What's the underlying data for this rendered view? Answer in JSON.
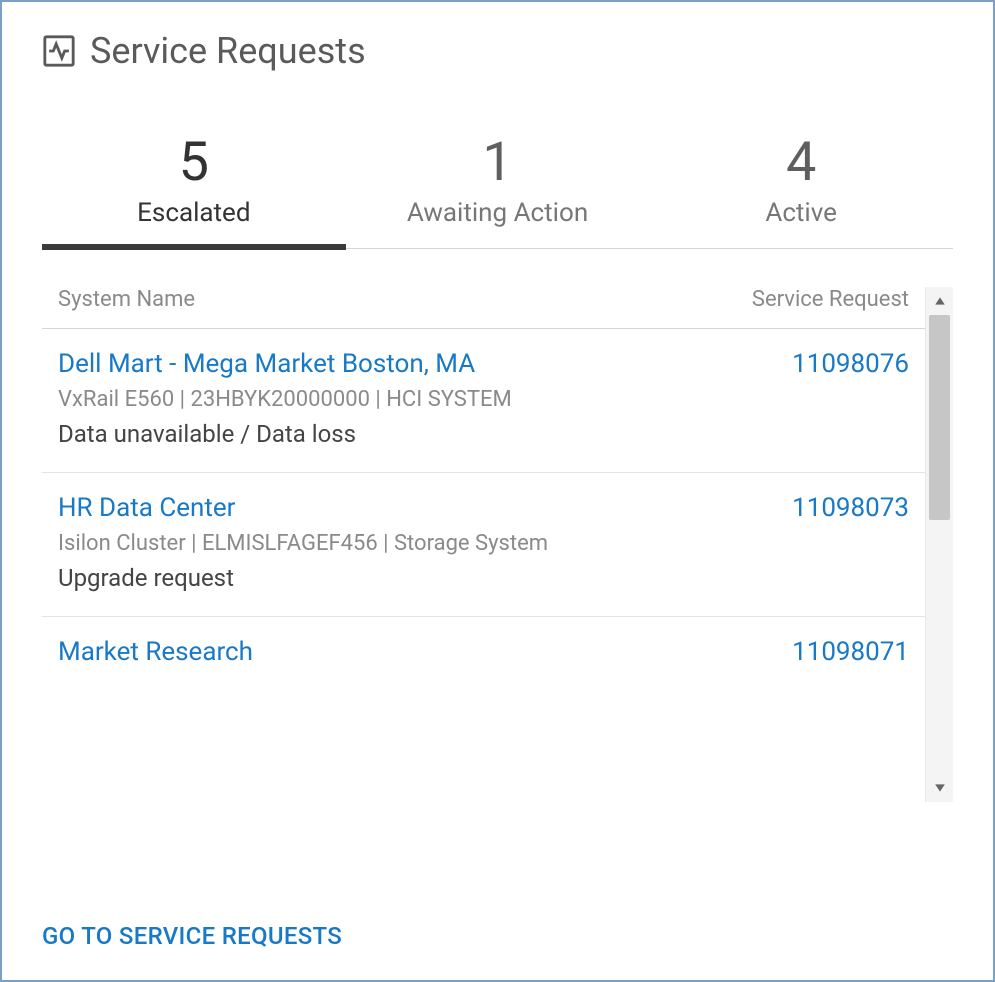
{
  "header": {
    "title": "Service Requests"
  },
  "tabs": [
    {
      "count": "5",
      "label": "Escalated",
      "selected": true
    },
    {
      "count": "1",
      "label": "Awaiting Action",
      "selected": false
    },
    {
      "count": "4",
      "label": "Active",
      "selected": false
    }
  ],
  "table": {
    "col_name": "System Name",
    "col_request": "Service Request",
    "rows": [
      {
        "system": "Dell Mart - Mega Market Boston, MA",
        "sub": "VxRail E560 | 23HBYK20000000 | HCI SYSTEM",
        "issue": "Data unavailable / Data loss",
        "request": "11098076"
      },
      {
        "system": "HR Data Center",
        "sub": "Isilon Cluster | ELMISLFAGEF456 | Storage System",
        "issue": "Upgrade request",
        "request": "11098073"
      },
      {
        "system": "Market Research",
        "sub": "",
        "issue": "",
        "request": "11098071"
      }
    ]
  },
  "footer_link": "GO TO SERVICE REQUESTS"
}
